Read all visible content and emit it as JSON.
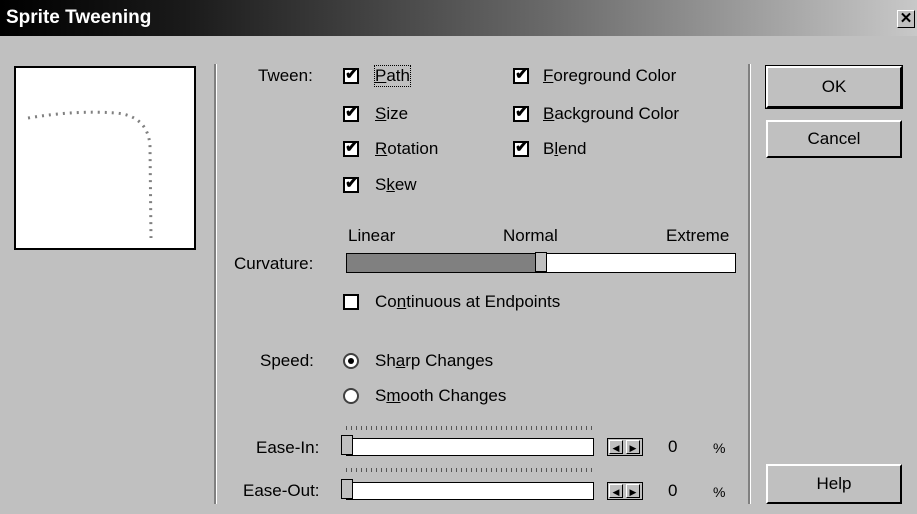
{
  "window": {
    "title": "Sprite Tweening",
    "close_glyph": "✕"
  },
  "tween": {
    "label": "Tween:",
    "options": [
      {
        "pre": "",
        "key": "P",
        "post": "ath",
        "checked": true
      },
      {
        "pre": "",
        "key": "S",
        "post": "ize",
        "checked": true
      },
      {
        "pre": "",
        "key": "R",
        "post": "otation",
        "checked": true
      },
      {
        "pre": "S",
        "key": "k",
        "post": "ew",
        "checked": true
      },
      {
        "pre": "",
        "key": "F",
        "post": "oreground Color",
        "checked": true
      },
      {
        "pre": "",
        "key": "B",
        "post": "ackground Color",
        "checked": true
      },
      {
        "pre": "B",
        "key": "l",
        "post": "end",
        "checked": true
      }
    ]
  },
  "curvature": {
    "label": "Curvature:",
    "min_label": "Linear",
    "mid_label": "Normal",
    "max_label": "Extreme",
    "value_fraction": 0.5
  },
  "continuous": {
    "pre": "Co",
    "key": "n",
    "post": "tinuous at Endpoints",
    "checked": false
  },
  "speed": {
    "label": "Speed:",
    "options": [
      {
        "pre": "Sh",
        "key": "a",
        "post": "rp Changes",
        "selected": true
      },
      {
        "pre": "S",
        "key": "m",
        "post": "ooth Changes",
        "selected": false
      }
    ]
  },
  "ease_in": {
    "label": "Ease-In:",
    "value": "0",
    "unit": "%"
  },
  "ease_out": {
    "label": "Ease-Out:",
    "value": "0",
    "unit": "%"
  },
  "buttons": {
    "ok": "OK",
    "cancel": "Cancel",
    "help": "Help"
  },
  "spinner": {
    "left": "◀",
    "right": "▶"
  },
  "check_glyph": "✔"
}
